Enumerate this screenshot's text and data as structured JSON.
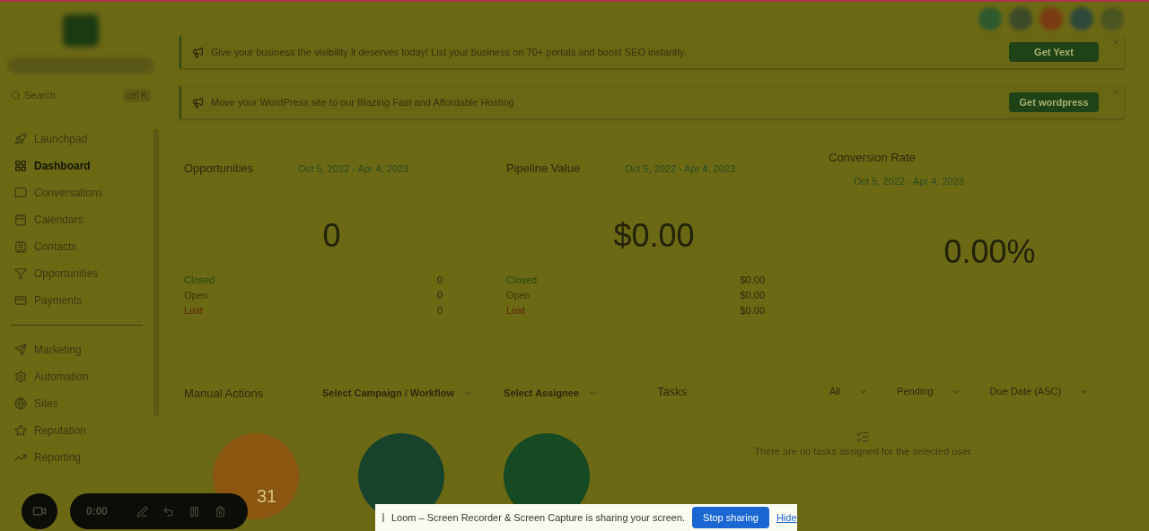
{
  "sidebar": {
    "search": {
      "placeholder": "Search",
      "shortcut": "ctrl K"
    },
    "items": [
      {
        "label": "Launchpad",
        "selected": false
      },
      {
        "label": "Dashboard",
        "selected": true
      },
      {
        "label": "Conversations",
        "selected": false
      },
      {
        "label": "Calendars",
        "selected": false
      },
      {
        "label": "Contacts",
        "selected": false
      },
      {
        "label": "Opportunities",
        "selected": false
      },
      {
        "label": "Payments",
        "selected": false
      }
    ],
    "items_2": [
      {
        "label": "Marketing",
        "selected": false
      },
      {
        "label": "Automation",
        "selected": false
      },
      {
        "label": "Sites",
        "selected": false
      },
      {
        "label": "Reputation",
        "selected": false
      },
      {
        "label": "Reporting",
        "selected": false
      }
    ]
  },
  "banners": [
    {
      "text": "Give your business the visibility it deserves today! List your business on 70+ portals and boost SEO instantly.",
      "button": "Get Yext"
    },
    {
      "text": "Move your WordPress site to our Blazing Fast and Affordable Hosting",
      "button": "Get wordpress"
    }
  ],
  "stats": [
    {
      "title": "Opportunities",
      "dates": "Oct 5, 2022 - Apr 4, 2023",
      "value": "0",
      "rows": [
        {
          "label": "Closed",
          "value": "0",
          "color": "#1f4a0c"
        },
        {
          "label": "Open",
          "value": "0",
          "color": "#3e3608"
        },
        {
          "label": "Lost",
          "value": "0",
          "color": "#5a1e06"
        }
      ]
    },
    {
      "title": "Pipeline Value",
      "dates": "Oct 5, 2022 - Apr 4, 2023",
      "value": "$0.00",
      "rows": [
        {
          "label": "Closed",
          "value": "$0.00",
          "color": "#1f4a0c"
        },
        {
          "label": "Open",
          "value": "$0.00",
          "color": "#3e3608"
        },
        {
          "label": "Lost",
          "value": "$0.00",
          "color": "#5a1e06"
        }
      ]
    },
    {
      "title": "Conversion Rate",
      "dates": "Oct 5, 2022 - Apr 4, 2023",
      "value": "0.00%"
    }
  ],
  "manual_actions": {
    "title": "Manual Actions",
    "filters": [
      "Select Campaign / Workflow",
      "Select Assignee"
    ],
    "circles": [
      {
        "label": "31",
        "color": "#8a5610"
      },
      {
        "color": "#17432c"
      },
      {
        "color": "#164a22"
      }
    ]
  },
  "tasks": {
    "title": "Tasks",
    "filters": [
      "All",
      "Pending",
      "Due Date (ASC)"
    ],
    "empty": "There are no tasks assigned for the selected user"
  },
  "recorder": {
    "time": "0:00"
  },
  "share_bar": {
    "text": "Loom – Screen Recorder & Screen Capture is sharing your screen.",
    "button": "Stop sharing",
    "link": "Hide"
  }
}
